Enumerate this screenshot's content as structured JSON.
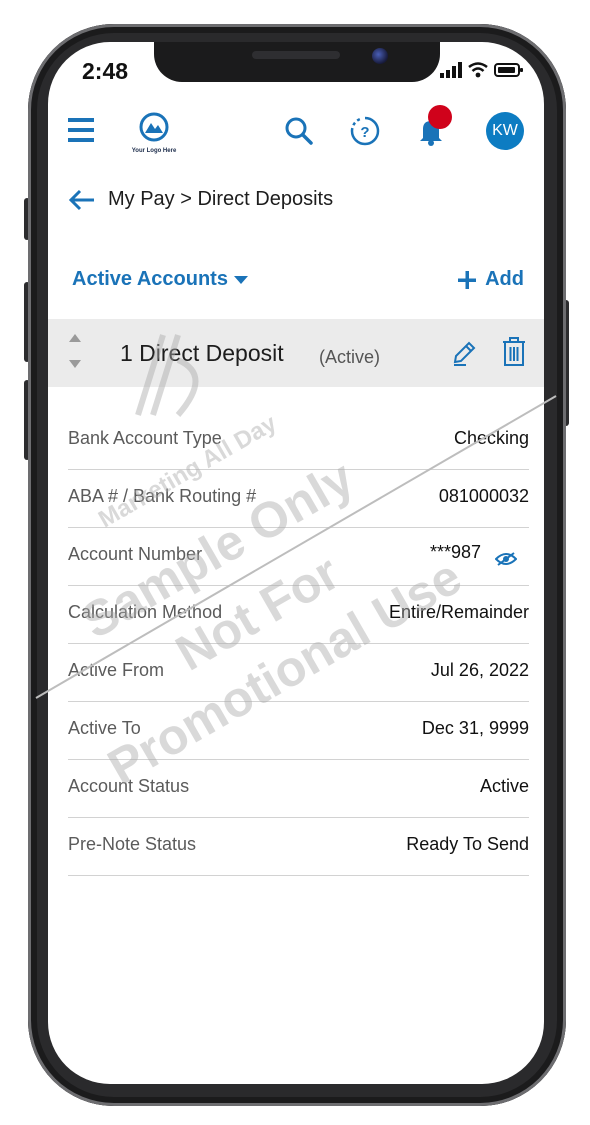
{
  "status_bar": {
    "time": "2:48"
  },
  "header": {
    "logo_text": "Your Logo Here",
    "avatar_initials": "KW",
    "icons": [
      "menu-icon",
      "logo-mountain-icon",
      "search-icon",
      "help-icon",
      "bell-icon"
    ]
  },
  "breadcrumb": {
    "text": "My Pay > Direct Deposits"
  },
  "filter": {
    "label": "Active Accounts",
    "add_label": "Add"
  },
  "deposit": {
    "title": "1 Direct Deposit",
    "status": "(Active)"
  },
  "details": [
    {
      "label": "Bank Account Type",
      "value": "Checking"
    },
    {
      "label": "ABA # / Bank Routing #",
      "value": "081000032"
    },
    {
      "label": "Account Number",
      "value": "***987"
    },
    {
      "label": "Calculation Method",
      "value": "Entire/Remainder"
    },
    {
      "label": "Active From",
      "value": "Jul 26, 2022"
    },
    {
      "label": "Active To",
      "value": "Dec 31, 9999"
    },
    {
      "label": "Account Status",
      "value": "Active"
    },
    {
      "label": "Pre-Note Status",
      "value": "Ready To Send"
    }
  ],
  "watermark": {
    "line1": "Marketing All Day",
    "line2": "Sample Only",
    "line3": "Not For",
    "line4": "Promotional Use"
  },
  "colors": {
    "accent": "#1a73b8",
    "avatar": "#0d7cc2",
    "notification": "#d0021b"
  }
}
